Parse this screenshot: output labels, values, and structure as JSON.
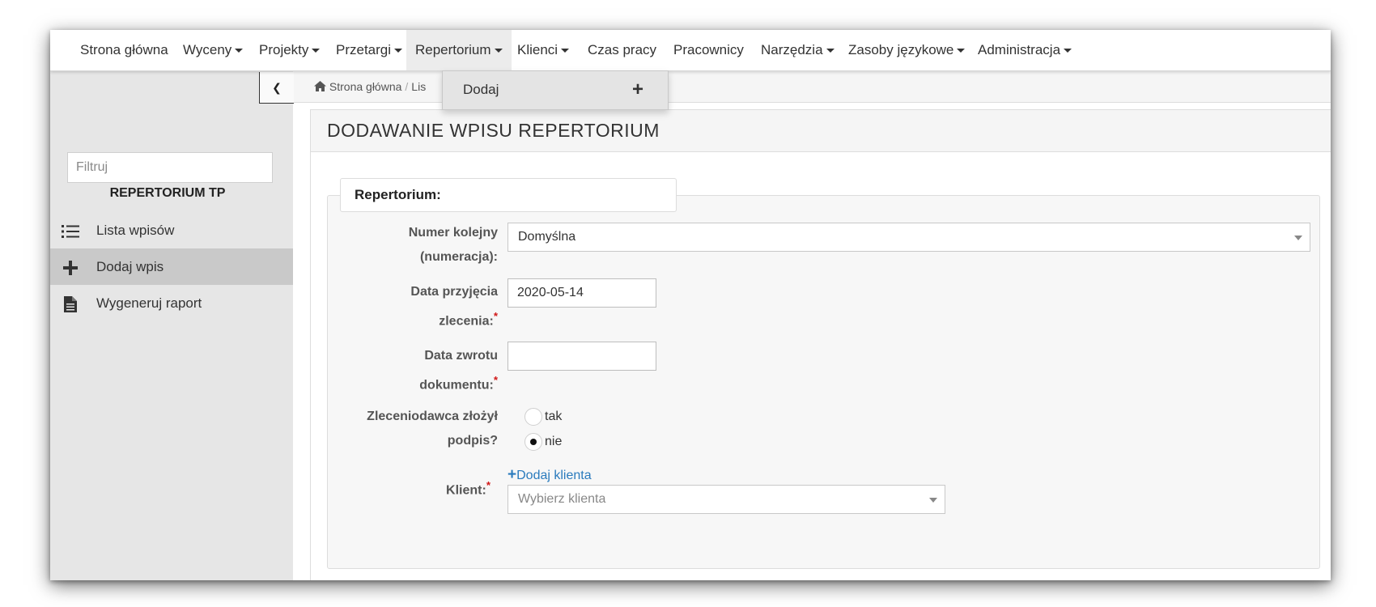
{
  "nav": {
    "items": [
      {
        "label": "Strona główna",
        "dropdown": false
      },
      {
        "label": "Wyceny",
        "dropdown": true
      },
      {
        "label": "Projekty",
        "dropdown": true
      },
      {
        "label": "Przetargi",
        "dropdown": true
      },
      {
        "label": "Repertorium",
        "dropdown": true,
        "active": true
      },
      {
        "label": "Klienci",
        "dropdown": true
      },
      {
        "label": "Czas pracy",
        "dropdown": false
      },
      {
        "label": "Pracownicy",
        "dropdown": false
      },
      {
        "label": "Narzędzia",
        "dropdown": true
      },
      {
        "label": "Zasoby językowe",
        "dropdown": true
      },
      {
        "label": "Administracja",
        "dropdown": true
      }
    ]
  },
  "dropdown": {
    "items": [
      {
        "label": "Dodaj",
        "icon": "plus-icon"
      }
    ]
  },
  "breadcrumb": {
    "home": "Strona główna",
    "partial": "Lis"
  },
  "sidebar": {
    "filter_placeholder": "Filtruj",
    "title": "REPERTORIUM TP",
    "items": [
      {
        "label": "Lista wpisów",
        "icon": "list-icon",
        "active": false
      },
      {
        "label": "Dodaj wpis",
        "icon": "plus-icon",
        "active": true
      },
      {
        "label": "Wygeneruj raport",
        "icon": "file-icon",
        "active": false
      }
    ]
  },
  "panel": {
    "title": "DODAWANIE WPISU REPERTORIUM"
  },
  "form": {
    "legend": "Repertorium:",
    "numbering": {
      "label_line1": "Numer kolejny",
      "label_line2": "(numeracja):",
      "value": "Domyślna"
    },
    "date_accept": {
      "label_line1": "Data przyjęcia",
      "label_line2": "zlecenia:",
      "value": "2020-05-14"
    },
    "date_return": {
      "label_line1": "Data zwrotu",
      "label_line2": "dokumentu:",
      "value": ""
    },
    "signature": {
      "label_line1": "Zleceniodawca złożył",
      "label_line2": "podpis?",
      "options": [
        "tak",
        "nie"
      ],
      "selected": "nie"
    },
    "client": {
      "label": "Klient:",
      "add_link": "Dodaj klienta",
      "placeholder": "Wybierz klienta"
    }
  },
  "colors": {
    "required": "#d01818",
    "link": "#2a7bbd",
    "sidebar_bg": "#e6e6e6",
    "sidebar_active": "#c9c9c9"
  }
}
